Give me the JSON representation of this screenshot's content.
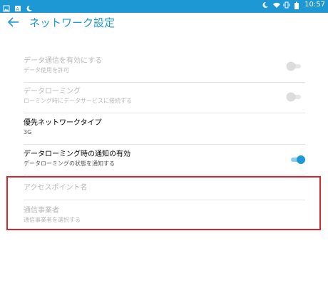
{
  "statusbar": {
    "time": "10:57",
    "icons": [
      "image-icon",
      "a-icon",
      "moon-icon",
      "moon-icon",
      "wifi-icon",
      "vibrate-icon",
      "battery-icon"
    ]
  },
  "appbar": {
    "title": "ネットワーク設定"
  },
  "settings": [
    {
      "title": "データ通信を有効にする",
      "subtitle": "データ使用を許可",
      "enabled": false,
      "toggle": "off"
    },
    {
      "title": "データローミング",
      "subtitle": "ローミング時にデータサービスに接続する",
      "enabled": false,
      "toggle": "off"
    },
    {
      "title": "優先ネットワークタイプ",
      "subtitle": "3G",
      "enabled": true
    },
    {
      "title": "データローミング時の通知の有効",
      "subtitle": "データローミングの状態を通知する",
      "enabled": true,
      "toggle": "on"
    },
    {
      "title": "アクセスポイント名",
      "enabled": false
    },
    {
      "title": "通信事業者",
      "subtitle": "通信事業者を選択する",
      "enabled": false
    }
  ],
  "colors": {
    "accent": "#1e98d4",
    "highlight": "#d8262c"
  }
}
